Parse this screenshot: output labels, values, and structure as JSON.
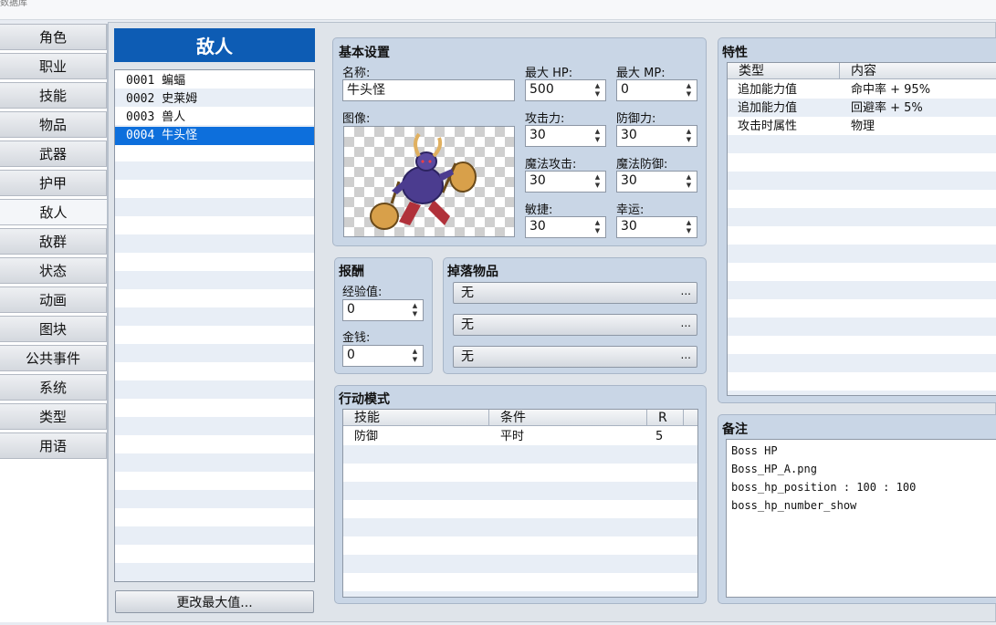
{
  "app": {
    "title_fragment": "数据库"
  },
  "tabs": [
    "角色",
    "职业",
    "技能",
    "物品",
    "武器",
    "护甲",
    "敌人",
    "敌群",
    "状态",
    "动画",
    "图块",
    "公共事件",
    "系统",
    "类型",
    "用语"
  ],
  "active_tab": 6,
  "enemy_list": {
    "header": "敌人",
    "items": [
      "0001 蝙蝠",
      "0002 史莱姆",
      "0003 兽人",
      "0004 牛头怪"
    ],
    "selected": 3,
    "change_max_button": "更改最大值..."
  },
  "basic": {
    "title": "基本设置",
    "name_label": "名称:",
    "name_value": "牛头怪",
    "image_label": "图像:",
    "image_icon": "minotaur-battler",
    "stats": [
      {
        "label": "最大 HP:",
        "value": "500"
      },
      {
        "label": "最大 MP:",
        "value": "0"
      },
      {
        "label": "攻击力:",
        "value": "30"
      },
      {
        "label": "防御力:",
        "value": "30"
      },
      {
        "label": "魔法攻击:",
        "value": "30"
      },
      {
        "label": "魔法防御:",
        "value": "30"
      },
      {
        "label": "敏捷:",
        "value": "30"
      },
      {
        "label": "幸运:",
        "value": "30"
      }
    ]
  },
  "reward": {
    "title": "报酬",
    "exp_label": "经验值:",
    "exp_value": "0",
    "gold_label": "金钱:",
    "gold_value": "0"
  },
  "drops": {
    "title": "掉落物品",
    "items": [
      "无",
      "无",
      "无"
    ],
    "dots": "..."
  },
  "actions": {
    "title": "行动模式",
    "columns": [
      "技能",
      "条件",
      "R"
    ],
    "rows": [
      {
        "skill": "防御",
        "condition": "平时",
        "rating": "5"
      }
    ]
  },
  "traits": {
    "title": "特性",
    "columns": [
      "类型",
      "内容"
    ],
    "rows": [
      {
        "type": "追加能力值",
        "content": "命中率 + 95%"
      },
      {
        "type": "追加能力值",
        "content": "回避率 + 5%"
      },
      {
        "type": "攻击时属性",
        "content": "物理"
      }
    ]
  },
  "note": {
    "title": "备注",
    "lines": [
      "Boss HP",
      "Boss_HP_A.png",
      "boss_hp_position : 100 : 100",
      "boss_hp_number_show"
    ]
  }
}
